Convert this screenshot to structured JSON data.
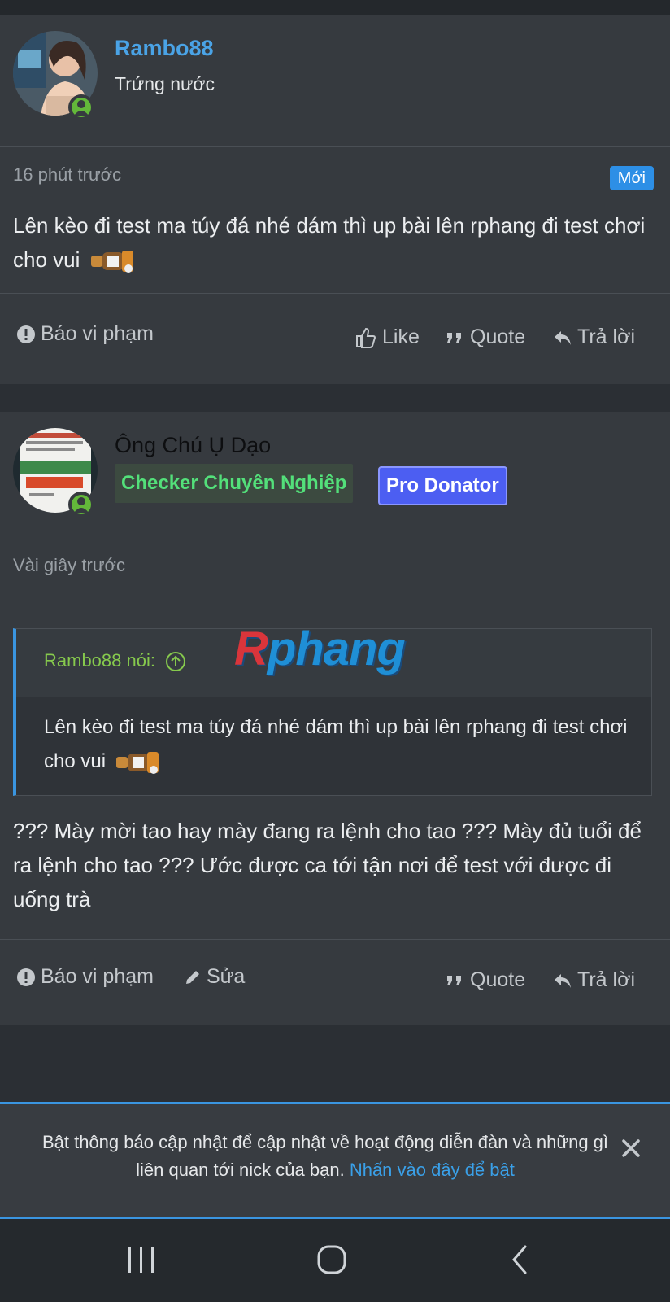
{
  "post1": {
    "username": "Rambo88",
    "user_title": "Trứng nước",
    "time": "16 phút trước",
    "badge": "Mới",
    "content": "Lên kèo đi test ma túy đá nhé dám thì up bài lên rphang đi test chơi cho vui",
    "actions": {
      "report": "Báo vi phạm",
      "like": "Like",
      "quote": "Quote",
      "reply": "Trả lời"
    }
  },
  "post2": {
    "username": "Ông Chú Ụ Dạo",
    "banners": [
      "Checker Chuyên Nghiệp",
      "Pro Donator"
    ],
    "time": "Vài giây trước",
    "quote": {
      "attribution": "Rambo88 nói:",
      "text": "Lên kèo đi test ma túy đá nhé dám thì up bài lên rphang đi test chơi cho vui"
    },
    "content": "??? Mày mời tao hay mày đang ra lệnh cho tao ??? Mày đủ tuổi để ra lệnh cho tao ??? Ước được ca tới tận nơi để test với được đi uống trà",
    "actions": {
      "report": "Báo vi phạm",
      "edit": "Sửa",
      "quote": "Quote",
      "reply": "Trả lời"
    }
  },
  "watermark": {
    "part1": "R",
    "part2": "phang"
  },
  "notification": {
    "text": "Bật thông báo cập nhật để cập nhật về hoạt động diễn đàn và những gì liên quan tới nick của bạn.",
    "link": "Nhấn vào đây để bật"
  },
  "icons": {
    "report": "exclamation-circle-icon",
    "like": "thumbs-up-icon",
    "quote": "quote-icon",
    "reply": "reply-arrow-icon",
    "edit": "pencil-icon",
    "close": "close-icon",
    "nav": [
      "recent-apps-icon",
      "home-icon",
      "back-icon"
    ]
  },
  "colors": {
    "background": "#2b2f34",
    "card": "#363a3f",
    "accent_blue": "#2d8fe6",
    "checker_green": "#53e07a",
    "pro_donator": "#4c5ef2",
    "online_green": "#63b83a"
  }
}
